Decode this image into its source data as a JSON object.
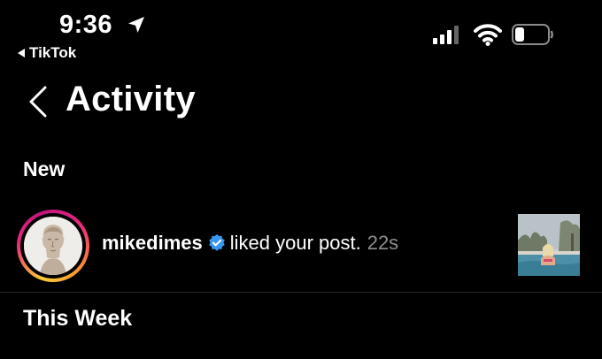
{
  "status_bar": {
    "time": "9:36",
    "back_app_label": "TikTok",
    "signal_bars": 3,
    "battery_level": 0.2
  },
  "header": {
    "title": "Activity",
    "back_icon": "chevron-left-icon"
  },
  "sections": {
    "new_label": "New",
    "this_week_label": "This Week"
  },
  "activity": {
    "username": "mikedimes",
    "verified": true,
    "action_text": "liked your post.",
    "time_ago": "22s",
    "avatar_icon": "statue-bust-avatar",
    "thumbnail_icon": "pool-photo-thumbnail"
  },
  "colors": {
    "background": "#000000",
    "text": "#ffffff",
    "muted": "#8e8e8e",
    "verified_blue": "#3897f0",
    "ring_start": "#f9ce34",
    "ring_mid": "#ee2a7b",
    "ring_end": "#c0157f"
  }
}
